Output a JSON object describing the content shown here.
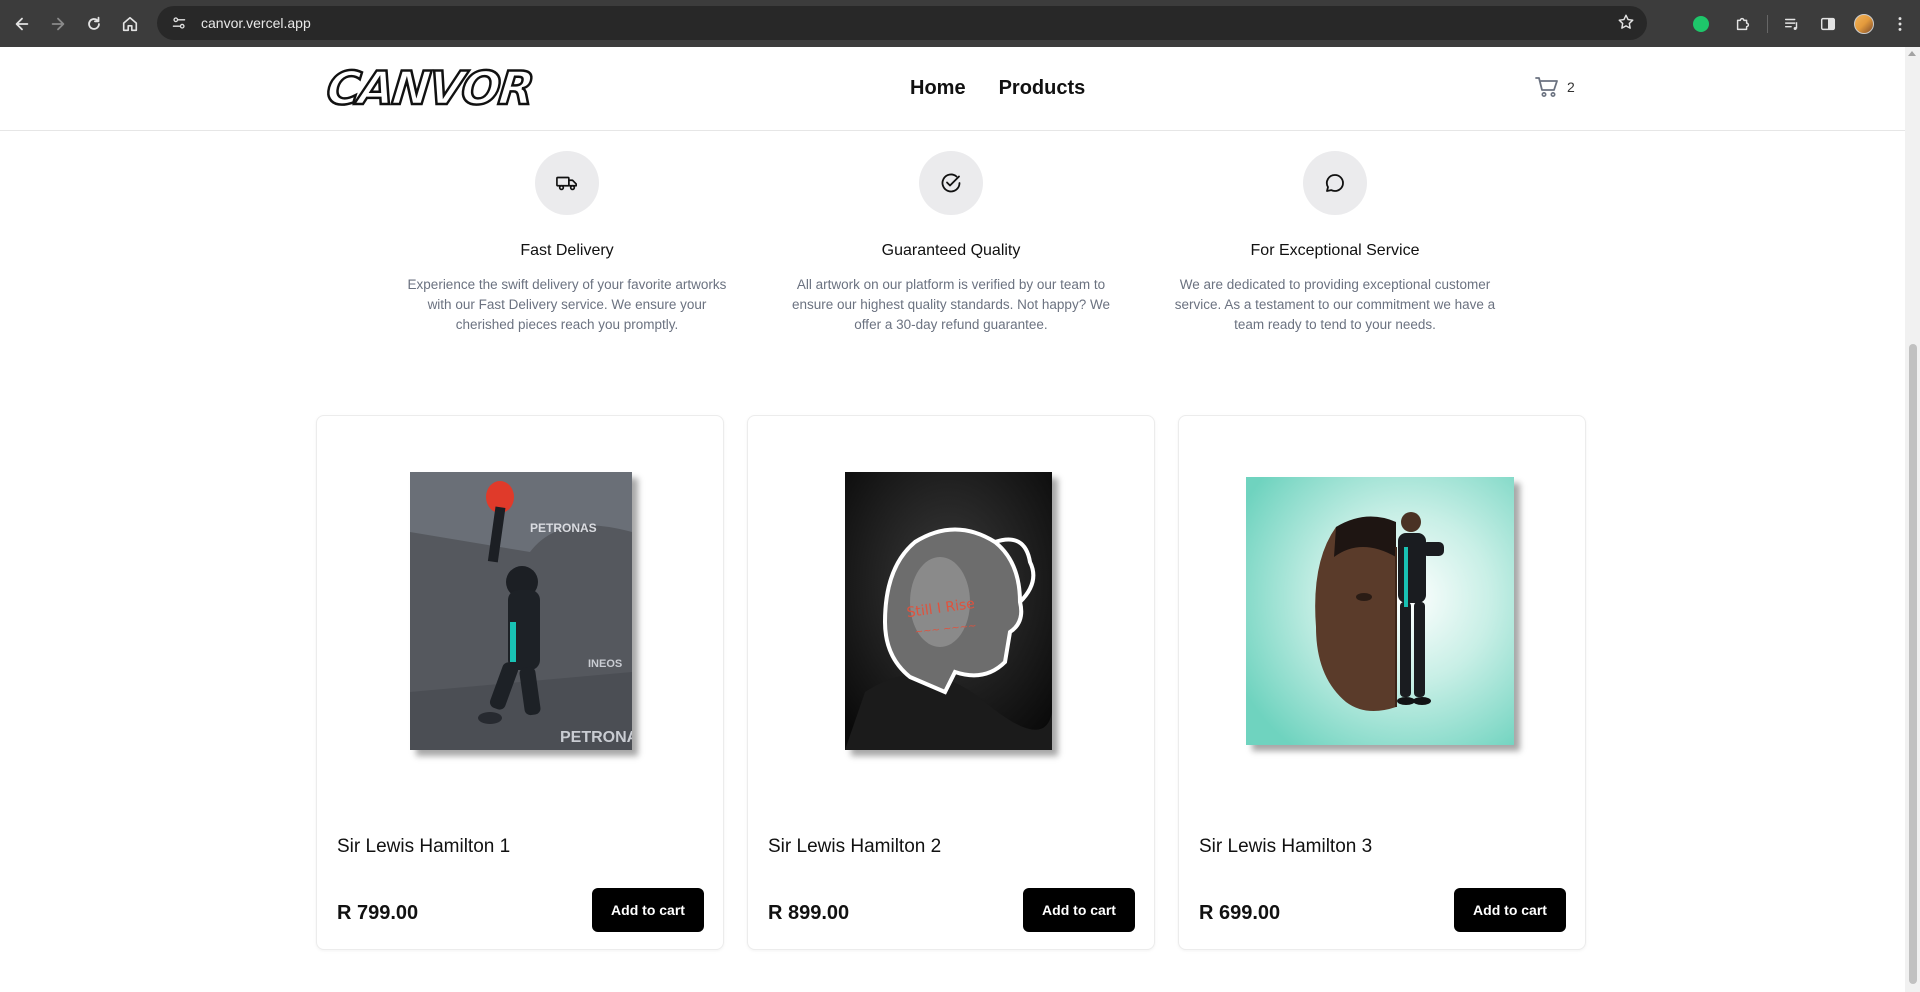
{
  "browser": {
    "url": "canvor.vercel.app"
  },
  "site": {
    "logo_text": "CANVOR",
    "nav": [
      {
        "label": "Home"
      },
      {
        "label": "Products"
      }
    ],
    "cart_count": "2"
  },
  "features": [
    {
      "icon": "truck-icon",
      "title": "Fast Delivery",
      "description": "Experience the swift delivery of your favorite artworks with our Fast Delivery service. We ensure your cherished pieces reach you promptly."
    },
    {
      "icon": "check-circle-icon",
      "title": "Guaranteed Quality",
      "description": "All artwork on our platform is verified by our team to ensure our highest quality standards. Not happy? We offer a 30-day refund guarantee."
    },
    {
      "icon": "chat-bubble-icon",
      "title": "For Exceptional Service",
      "description": "We are dedicated to providing exceptional customer service. As a testament to our commitment we have a team ready to tend to your needs."
    }
  ],
  "products": [
    {
      "name": "Sir Lewis Hamilton 1",
      "price": "R 799.00",
      "button": "Add to cart"
    },
    {
      "name": "Sir Lewis Hamilton 2",
      "price": "R 899.00",
      "button": "Add to cart"
    },
    {
      "name": "Sir Lewis Hamilton 3",
      "price": "R 699.00",
      "button": "Add to cart"
    }
  ],
  "colors": {
    "chrome_bg": "#3c3c3c",
    "omnibox_bg": "#282828",
    "button_bg": "#000000",
    "feature_circle": "#ebebed",
    "muted_text": "#6b7280",
    "poster3_bg": "#6fd3bf"
  }
}
